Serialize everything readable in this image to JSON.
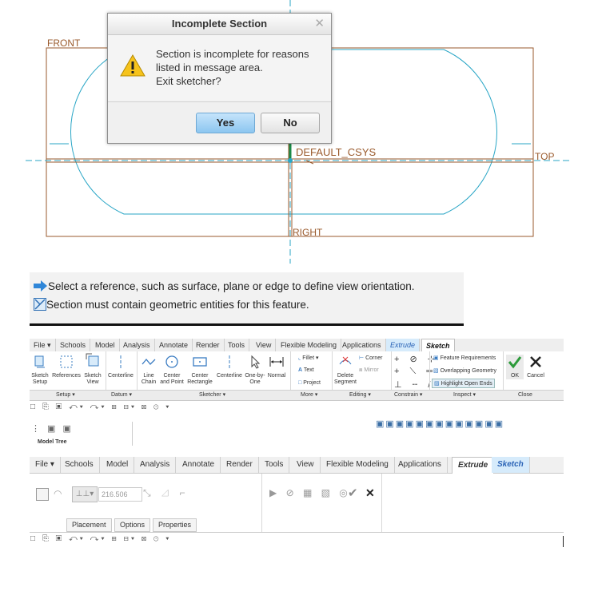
{
  "dialog": {
    "title": "Incomplete Section",
    "close_glyph": "✕",
    "message_line1": "Section is incomplete for reasons",
    "message_line2": "listed in message area.",
    "message_line3": "Exit sketcher?",
    "yes_label": "Yes",
    "no_label": "No",
    "icon": "warning-icon"
  },
  "sketch": {
    "front_label": "FRONT",
    "top_label": "TOP",
    "csys_label": "DEFAULT_CSYS",
    "right_label": "RIGHT",
    "colors": {
      "datum": "#9a5a2c",
      "geometry": "#2aa6c6",
      "reference": "#1c8a48"
    }
  },
  "message_area": {
    "line1": "Select a reference, such as surface, plane or edge to define view orientation.",
    "line2": "Section must contain geometric entities for this feature.",
    "icon1": "arrow-right-icon",
    "icon2": "sketch-error-icon"
  },
  "ribbon": {
    "tabs": [
      "File ▾",
      "Schools",
      "Model",
      "Analysis",
      "Annotate",
      "Render",
      "Tools",
      "View",
      "Flexible Modeling",
      "Applications",
      "Extrude",
      "Sketch"
    ],
    "setup": {
      "sketch_setup": [
        "Sketch",
        "Setup"
      ],
      "references": "References",
      "sketch_view": [
        "Sketch",
        "View"
      ]
    },
    "datum": {
      "centerline": "Centerline"
    },
    "sketcher": {
      "line_chain": [
        "Line",
        "Chain"
      ],
      "center_point": [
        "Center",
        "and Point"
      ],
      "center_rectangle": [
        "Center",
        "Rectangle"
      ],
      "centerline": "Centerline",
      "one_by_one": [
        "One-by-",
        "One"
      ],
      "normal": "Normal"
    },
    "more": {
      "fillet": "Fillet ▾",
      "text": "Text",
      "project": "Project"
    },
    "editing": {
      "delete_segment": [
        "Delete",
        "Segment"
      ],
      "corner": "Corner",
      "mirror": "Mirror"
    },
    "inspect": {
      "feature_requirements": "Feature Requirements",
      "overlapping_geometry": "Overlapping Geometry",
      "highlight_open_ends": "Highlight Open Ends"
    },
    "close": {
      "ok": "OK",
      "cancel": "Cancel"
    },
    "groups": [
      "Setup ▾",
      "Datum ▾",
      "Sketcher ▾",
      "More ▾",
      "Editing ▾",
      "Constrain ▾",
      "Inspect ▾",
      "Close"
    ]
  },
  "model_tree": {
    "label": "Model Tree"
  },
  "lower_ribbon": {
    "tabs": [
      "File ▾",
      "Schools",
      "Model",
      "Analysis",
      "Annotate",
      "Render",
      "Tools",
      "View",
      "Flexible Modeling",
      "Applications",
      "Extrude",
      "Sketch"
    ],
    "depth_value": "216.506",
    "subtabs": [
      "Placement",
      "Options",
      "Properties"
    ]
  }
}
